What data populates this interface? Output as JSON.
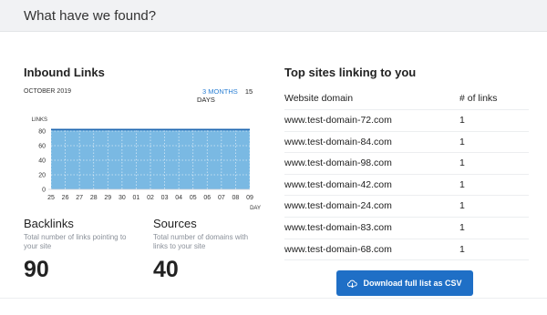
{
  "header": {
    "title": "What have we found?"
  },
  "inbound": {
    "title": "Inbound Links",
    "period": "OCTOBER 2019",
    "ranges": [
      {
        "label": "3 MONTHS",
        "active": true
      },
      {
        "label": "15 DAYS",
        "active": false
      }
    ]
  },
  "chart_data": {
    "type": "area",
    "y_axis_title": "LINKS",
    "x_axis_title": "DAY",
    "x": [
      "25",
      "26",
      "27",
      "28",
      "29",
      "30",
      "01",
      "02",
      "03",
      "04",
      "05",
      "06",
      "07",
      "08",
      "09"
    ],
    "values": [
      82,
      82,
      82,
      82,
      82,
      82,
      82,
      82,
      82,
      82,
      82,
      82,
      82,
      82,
      82
    ],
    "yticks": [
      0,
      20,
      40,
      60,
      80
    ],
    "ylim": [
      0,
      90
    ],
    "color": "#7ab9e3",
    "line_color": "#1f67b1",
    "grid": true
  },
  "stats": {
    "backlinks": {
      "label": "Backlinks",
      "desc": "Total number of links pointing to your site",
      "value": "90"
    },
    "sources": {
      "label": "Sources",
      "desc": "Total number of domains with links to your site",
      "value": "40"
    }
  },
  "top_sites": {
    "title": "Top sites linking to you",
    "columns": [
      "Website domain",
      "# of links"
    ],
    "rows": [
      {
        "domain": "www.test-domain-72.com",
        "links": "1"
      },
      {
        "domain": "www.test-domain-84.com",
        "links": "1"
      },
      {
        "domain": "www.test-domain-98.com",
        "links": "1"
      },
      {
        "domain": "www.test-domain-42.com",
        "links": "1"
      },
      {
        "domain": "www.test-domain-24.com",
        "links": "1"
      },
      {
        "domain": "www.test-domain-83.com",
        "links": "1"
      },
      {
        "domain": "www.test-domain-68.com",
        "links": "1"
      }
    ],
    "download_label": "Download full list as CSV",
    "download_icon": "cloud-download-icon"
  }
}
